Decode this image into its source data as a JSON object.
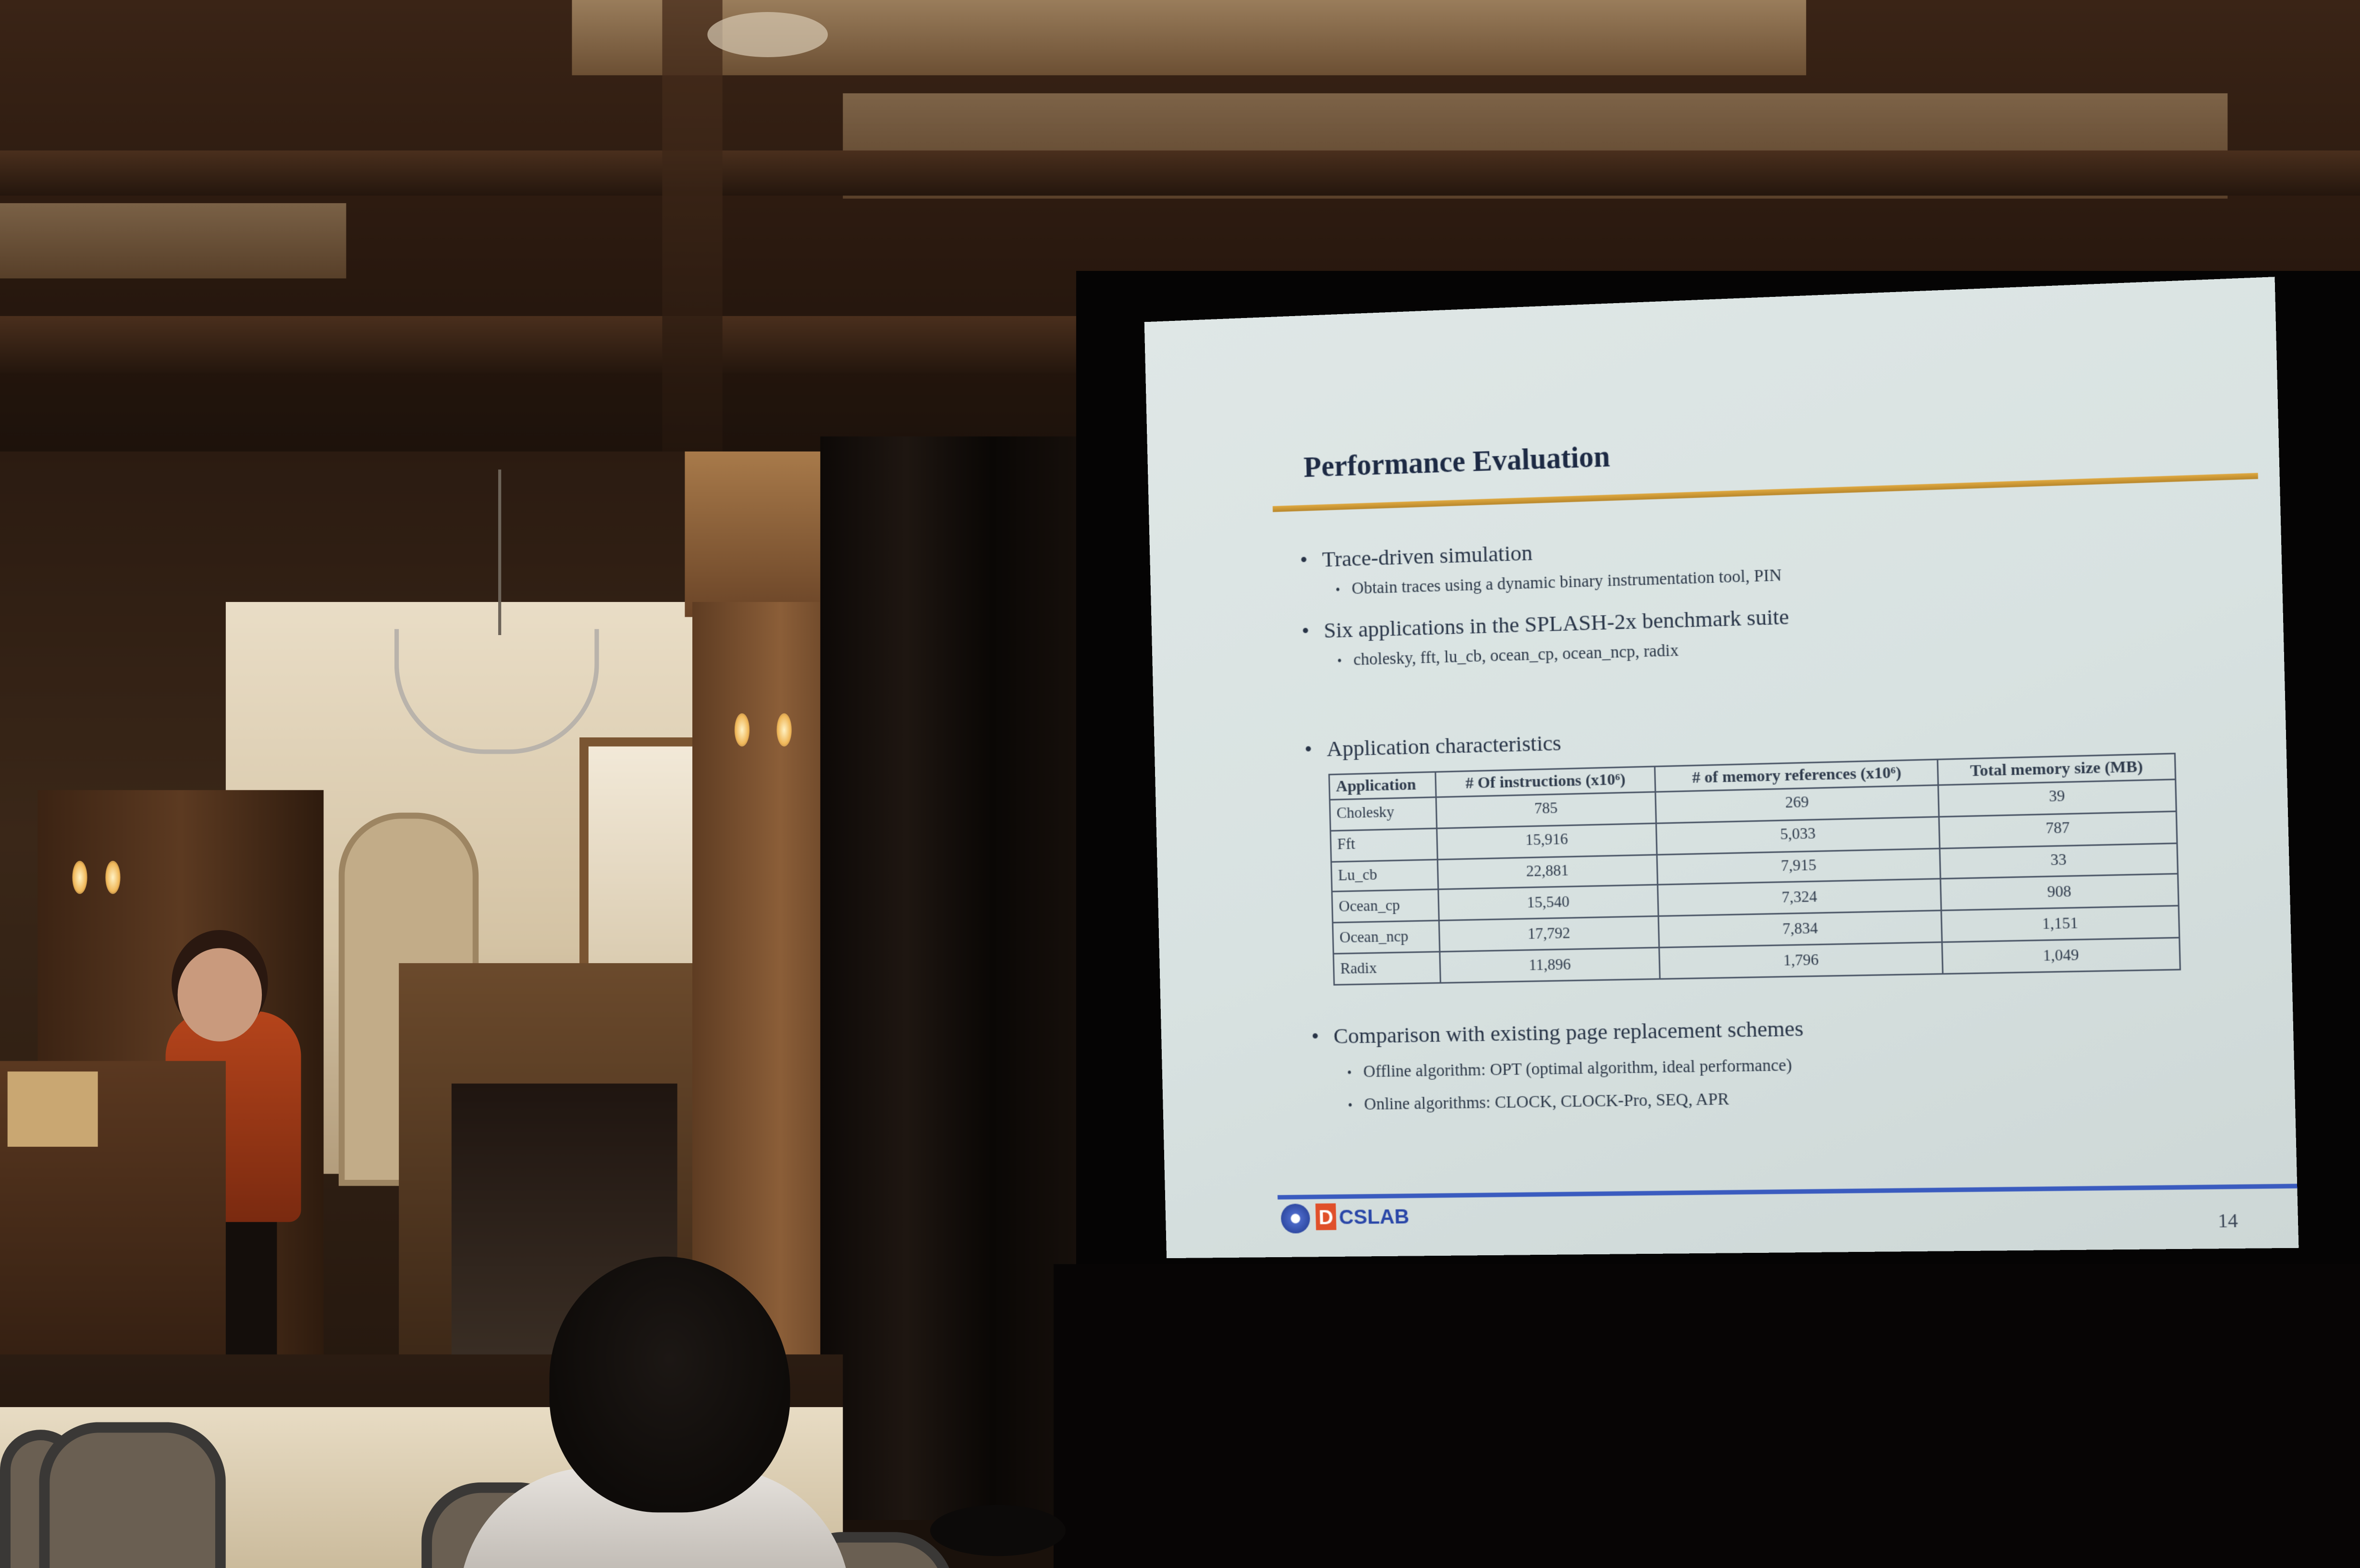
{
  "slide": {
    "title": "Performance Evaluation",
    "bullets": [
      {
        "text": "Trace-driven simulation",
        "subs": [
          "Obtain traces using a dynamic binary instrumentation tool, PIN"
        ]
      },
      {
        "text": "Six applications in the SPLASH-2x benchmark suite",
        "subs": [
          "cholesky, fft, lu_cb, ocean_cp, ocean_ncp, radix"
        ]
      },
      {
        "text": "Application characteristics",
        "subs": []
      },
      {
        "text": "Comparison with existing page replacement schemes",
        "subs": [
          "Offline algorithm: OPT (optimal algorithm, ideal performance)",
          "Online algorithms: CLOCK, CLOCK-Pro, SEQ, APR"
        ]
      }
    ],
    "table": {
      "headers": [
        "Application",
        "# Of instructions (x10⁶)",
        "# of memory references (x10⁶)",
        "Total memory size (MB)"
      ],
      "rows": [
        [
          "Cholesky",
          "785",
          "269",
          "39"
        ],
        [
          "Fft",
          "15,916",
          "5,033",
          "787"
        ],
        [
          "Lu_cb",
          "22,881",
          "7,915",
          "33"
        ],
        [
          "Ocean_cp",
          "15,540",
          "7,324",
          "908"
        ],
        [
          "Ocean_ncp",
          "17,792",
          "7,834",
          "1,151"
        ],
        [
          "Radix",
          "11,896",
          "1,796",
          "1,049"
        ]
      ]
    },
    "logo_letter": "D",
    "logo_text": "CSLAB",
    "page_number": "14"
  }
}
